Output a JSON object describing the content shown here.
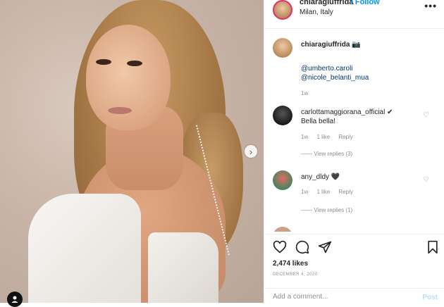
{
  "post": {
    "username": "chiaragiuffrida",
    "follow_label": "• Follow",
    "location": "Milan, Italy",
    "more_icon": "more-dots-icon",
    "next_icon": "›"
  },
  "comments": [
    {
      "user": "chiaragiuffrida",
      "text": "📷",
      "mentions": [
        "@umberto.caroli",
        "@nicole_belanti_mua"
      ],
      "time": "1w"
    },
    {
      "user": "carlottamaggiorana_official ✔",
      "text": "Bella bella!",
      "time": "1w",
      "likes": "1 like",
      "reply": "Reply",
      "view_replies": "—— View replies (3)"
    },
    {
      "user": "any_dldy 🖤",
      "text": "",
      "time": "1w",
      "likes": "1 like",
      "reply": "Reply",
      "view_replies": "—— View replies (1)"
    }
  ],
  "actions": {
    "likes": "2,474 likes",
    "date": "DECEMBER 4, 2020",
    "comment_placeholder": "Add a comment...",
    "post_label": "Post"
  },
  "colors": {
    "accent": "#0095f6",
    "post_disabled": "#b2dffc",
    "story_ring": "#e1306c"
  }
}
